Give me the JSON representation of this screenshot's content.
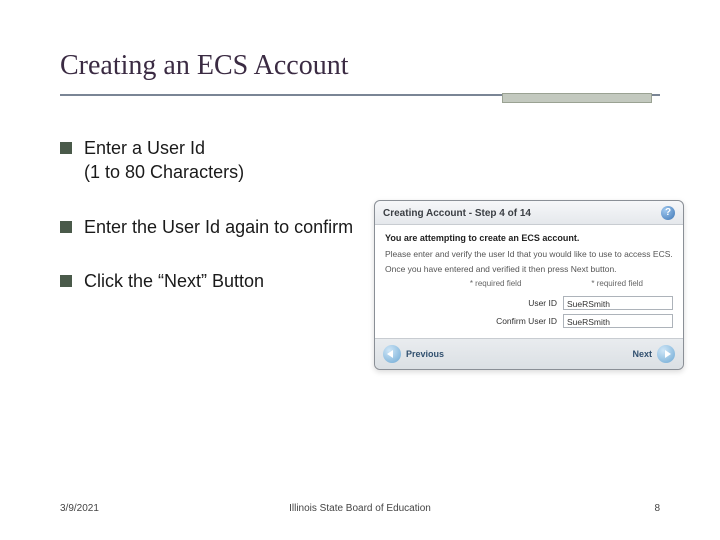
{
  "title": "Creating an ECS Account",
  "bullets": [
    {
      "line1": "Enter a User Id",
      "line2": "(1 to 80 Characters)"
    },
    {
      "line1": "Enter the User Id again to confirm",
      "line2": ""
    },
    {
      "line1": "Click the “Next” Button",
      "line2": ""
    }
  ],
  "modal": {
    "head": "Creating Account - Step 4 of 14",
    "bold": "You are attempting to create an ECS account.",
    "p1": "Please enter and verify the user Id that you would like to use to access ECS.",
    "p2": "Once you have entered and verified it then press Next button.",
    "req1": "* required field",
    "req2": "* required field",
    "userIdLabel": "User ID",
    "userIdVal": "SueRSmith",
    "confirmLabel": "Confirm User ID",
    "confirmVal": "SueRSmith",
    "prev": "Previous",
    "next": "Next"
  },
  "footer": {
    "date": "3/9/2021",
    "org": "Illinois State Board of Education",
    "page": "8"
  }
}
